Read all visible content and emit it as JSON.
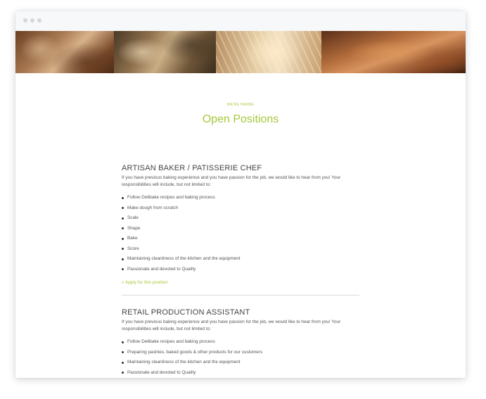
{
  "page": {
    "eyebrow": "WE'RE HIRING",
    "title": "Open Positions"
  },
  "positions": [
    {
      "title": "ARTISAN BAKER / PATISSERIE CHEF",
      "description": "If you have previous baking experience and you have passion for the job, we would like to hear from you! Your responsibilities will include, but not limited to:",
      "requirements": [
        "Follow Delibake recipes and baking process",
        "Make dough from scratch",
        "Scale",
        "Shape",
        "Bake",
        "Score",
        "Maintaining cleanliness of the kitchen and the equipment",
        "Passionate and devoted to Quality"
      ],
      "apply_label": "» Apply for this position"
    },
    {
      "title": "RETAIL PRODUCTION ASSISTANT",
      "description": "If you have previous baking experience and you have passion for the job, we would like to hear from you! Your responsibilities will include, but not limited to:",
      "requirements": [
        "Follow Delibake recipes and baking process",
        "Preparing pastries, baked goods & other products for our customers",
        "Maintaining cleanliness of the kitchen and the equipment",
        "Passionate and devoted to Quality"
      ]
    }
  ],
  "colors": {
    "accent": "#a7c83d",
    "text": "#555555",
    "heading": "#444444",
    "divider": "#dcdcdc"
  }
}
